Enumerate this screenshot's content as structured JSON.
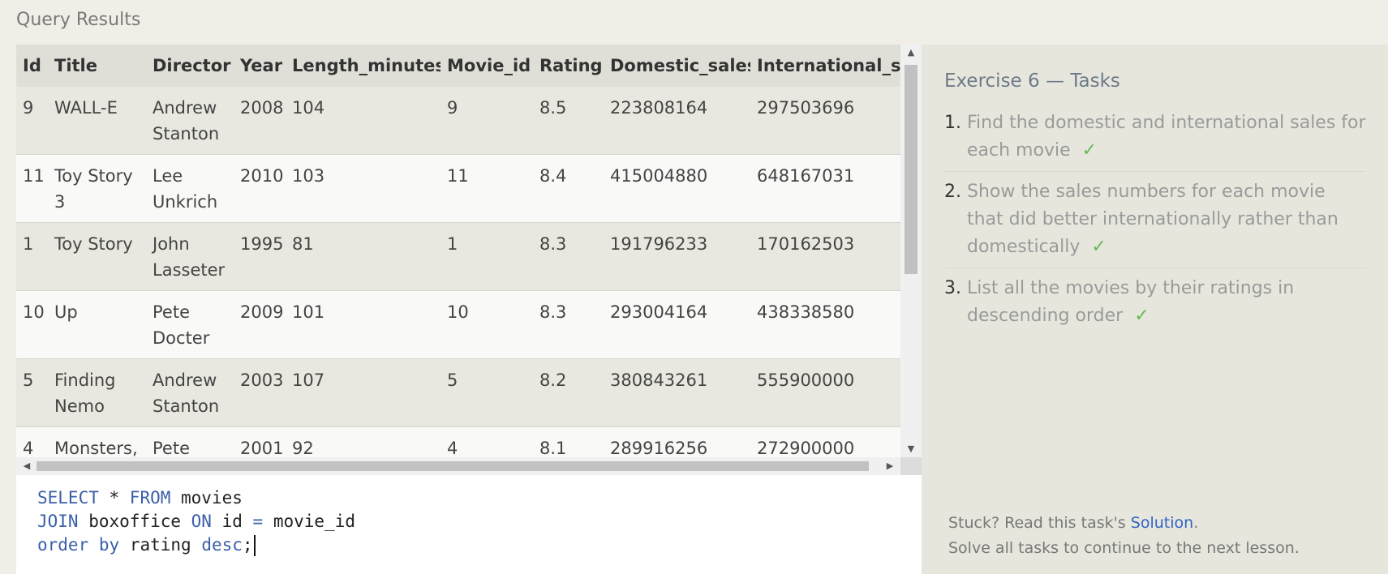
{
  "results": {
    "title": "Query Results",
    "columns": [
      "Id",
      "Title",
      "Director",
      "Year",
      "Length_minutes",
      "Movie_id",
      "Rating",
      "Domestic_sales",
      "International_sa"
    ],
    "rows": [
      {
        "id": "9",
        "title": "WALL-E",
        "director": "Andrew Stanton",
        "year": "2008",
        "length": "104",
        "movie_id": "9",
        "rating": "8.5",
        "domestic": "223808164",
        "international": "297503696"
      },
      {
        "id": "11",
        "title": "Toy Story 3",
        "director": "Lee Unkrich",
        "year": "2010",
        "length": "103",
        "movie_id": "11",
        "rating": "8.4",
        "domestic": "415004880",
        "international": "648167031"
      },
      {
        "id": "1",
        "title": "Toy Story",
        "director": "John Lasseter",
        "year": "1995",
        "length": "81",
        "movie_id": "1",
        "rating": "8.3",
        "domestic": "191796233",
        "international": "170162503"
      },
      {
        "id": "10",
        "title": "Up",
        "director": "Pete Docter",
        "year": "2009",
        "length": "101",
        "movie_id": "10",
        "rating": "8.3",
        "domestic": "293004164",
        "international": "438338580"
      },
      {
        "id": "5",
        "title": "Finding Nemo",
        "director": "Andrew Stanton",
        "year": "2003",
        "length": "107",
        "movie_id": "5",
        "rating": "8.2",
        "domestic": "380843261",
        "international": "555900000"
      },
      {
        "id": "4",
        "title": "Monsters, Inc.",
        "director": "Pete Docter",
        "year": "2001",
        "length": "92",
        "movie_id": "4",
        "rating": "8.1",
        "domestic": "289916256",
        "international": "272900000"
      }
    ]
  },
  "editor": {
    "lines": [
      [
        {
          "t": "SELECT",
          "kw": true
        },
        {
          "t": " * ",
          "kw": false
        },
        {
          "t": "FROM",
          "kw": true
        },
        {
          "t": " movies",
          "kw": false
        }
      ],
      [
        {
          "t": "JOIN",
          "kw": true
        },
        {
          "t": " boxoffice ",
          "kw": false
        },
        {
          "t": "ON",
          "kw": true
        },
        {
          "t": " id ",
          "kw": false
        },
        {
          "t": "=",
          "kw": true
        },
        {
          "t": " movie_id",
          "kw": false
        }
      ],
      [
        {
          "t": "order",
          "kw": true
        },
        {
          "t": " ",
          "kw": false
        },
        {
          "t": "by",
          "kw": true
        },
        {
          "t": " rating ",
          "kw": false
        },
        {
          "t": "desc",
          "kw": true
        },
        {
          "t": ";",
          "kw": false
        }
      ]
    ]
  },
  "tasks": {
    "title": "Exercise 6 — Tasks",
    "items": [
      {
        "num": "1.",
        "text": "Find the domestic and international sales for each movie",
        "check": "✓"
      },
      {
        "num": "2.",
        "text": "Show the sales numbers for each movie that did better internationally rather than domestically",
        "check": "✓"
      },
      {
        "num": "3.",
        "text": "List all the movies by their ratings in descending order",
        "check": "✓"
      }
    ],
    "footer_prefix": "Stuck? Read this task's ",
    "solution_link": "Solution",
    "footer_suffix": ".",
    "footer_line2": "Solve all tasks to continue to the next lesson."
  },
  "colors": {
    "keyword": "#3a5fa8",
    "check": "#67b957",
    "link": "#2f64c4"
  }
}
